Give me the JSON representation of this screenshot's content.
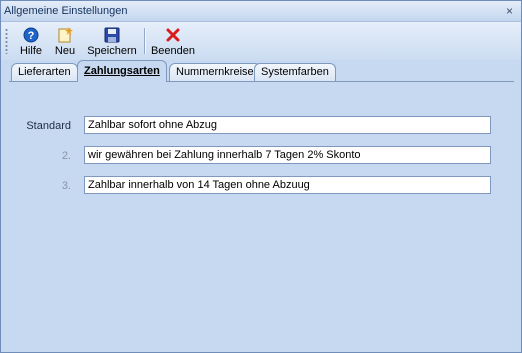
{
  "window": {
    "title": "Allgemeine Einstellungen",
    "close_glyph": "×"
  },
  "toolbar": {
    "buttons": [
      {
        "label": "Hilfe",
        "icon": "help-icon",
        "color": "#1e64c8"
      },
      {
        "label": "Neu",
        "icon": "new-document-icon",
        "color": "#e8a020"
      },
      {
        "label": "Speichern",
        "icon": "save-icon",
        "color": "#2a4aa8"
      },
      {
        "label": "Beenden",
        "icon": "close-icon",
        "color": "#d81c1c"
      }
    ]
  },
  "tabs": [
    {
      "label": "Lieferarten",
      "active": false
    },
    {
      "label": "Zahlungsarten",
      "active": true
    },
    {
      "label": "Nummernkreise",
      "active": false
    },
    {
      "label": "Systemfarben",
      "active": false
    }
  ],
  "payment_terms": [
    {
      "label": "Standard",
      "value": "Zahlbar sofort ohne Abzug"
    },
    {
      "label": "2.",
      "value": "wir gewähren bei Zahlung innerhalb 7 Tagen 2% Skonto"
    },
    {
      "label": "3.",
      "value": "Zahlbar innerhalb von 14 Tagen ohne Abzuug"
    }
  ],
  "colors": {
    "accent": "#c6d9f0",
    "border": "#7f98bd"
  }
}
